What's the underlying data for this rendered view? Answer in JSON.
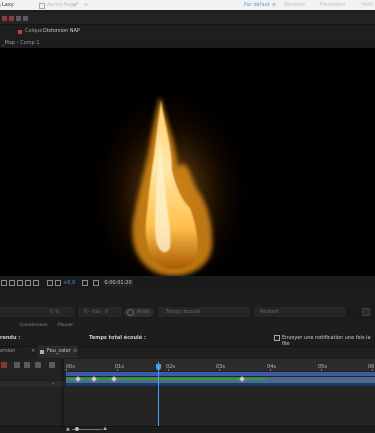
{
  "window": {
    "title": "Laxy"
  },
  "toolbar": {
    "snap_label": "Accrochage",
    "workspaces": [
      "Par défaut",
      "Révision",
      "Formation",
      "Petit"
    ],
    "active_workspace": "Par défaut",
    "workspace_menu_icon": "≡"
  },
  "composition_panel": {
    "layer_label": "Calque",
    "layer_name": "Distorsion NAP",
    "breadcrumb": "_Map › Comp 1"
  },
  "viewer": {
    "zoom_hint": "",
    "plus_label": "+0,0",
    "timecode": "0:00:01:20"
  },
  "render_queue": {
    "percent": "0 %",
    "fields": [
      "0 - Ital - 0",
      "Temps écoulé",
      "Restant"
    ],
    "stop_button": "Arrêt",
    "tabs": [
      "Conversions",
      "Pauser"
    ],
    "render_label": "rendu :",
    "elapsed_total_label": "Temps total écoulé :",
    "notify_label": "Envoyer une notification une fois la file"
  },
  "timeline": {
    "left_tab": "ersion",
    "active_tab": "Feu_color",
    "ruler_labels": [
      "00s",
      "01s",
      "02s",
      "03s",
      "04s",
      "05s",
      "06"
    ],
    "playhead_time_sec": 1.8,
    "colors": {
      "playhead": "#4a9ee8",
      "work_area": "#3d5aa8",
      "audio": "#2ba02b"
    }
  }
}
